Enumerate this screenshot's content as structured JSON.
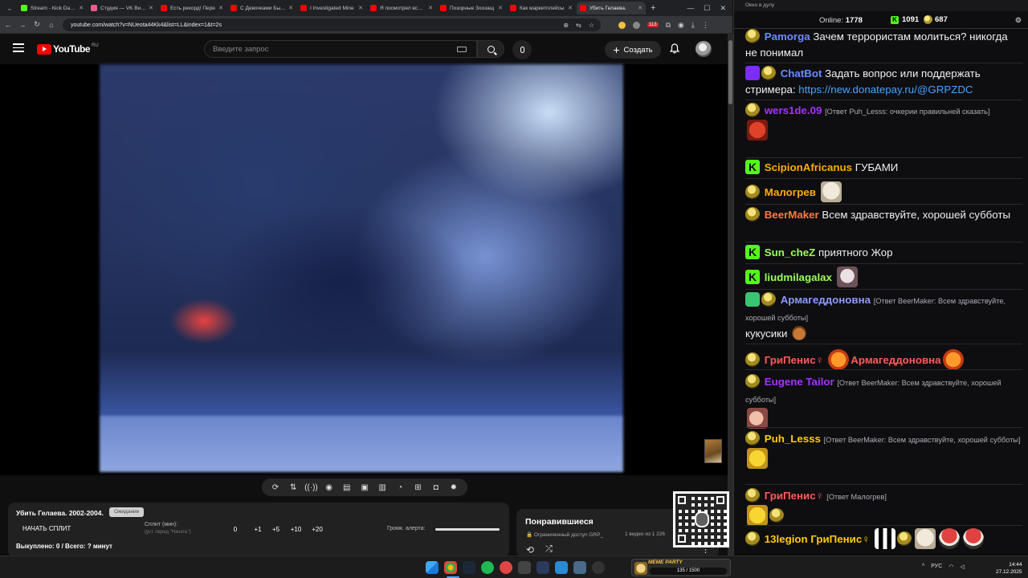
{
  "browser": {
    "tabs": [
      {
        "label": "Stream - Kick Dashb",
        "color": "#53fc18",
        "active": false
      },
      {
        "label": "Студия — VK Видео",
        "color": "#e85d8a",
        "active": false
      },
      {
        "label": "Есть рекорд! Пере",
        "color": "#ff0000",
        "active": false
      },
      {
        "label": "С Девочками Было",
        "color": "#ff0000",
        "active": false
      },
      {
        "label": "I Investigated Mine",
        "color": "#ff0000",
        "active": false
      },
      {
        "label": "Я посмотрел все ф",
        "color": "#ff0000",
        "active": false
      },
      {
        "label": "Позорные Зоозащ",
        "color": "#ff0000",
        "active": false
      },
      {
        "label": "Как маркетплейсы",
        "color": "#ff0000",
        "active": false
      },
      {
        "label": "Убить Гелаева.",
        "color": "#ff0000",
        "active": true
      }
    ],
    "url": "youtube.com/watch?v=NUeota44Kk4&list=LL&index=1&t=2s",
    "ext_badge": "113"
  },
  "youtube": {
    "logo_text": "YouTube",
    "region": "RU",
    "search_placeholder": "Введите запрос",
    "create_label": "Создать"
  },
  "panel": {
    "title": "Убить Гелаева. 2002-2004.",
    "badge": "Ожидание",
    "split_button": "НАЧАТЬ СПЛИТ",
    "split_label": "Сплит (мин):",
    "split_hint": "(уст. перед \"Начать\")",
    "split_values": [
      "0",
      "+1",
      "+5",
      "+10",
      "+20"
    ],
    "alert_label": "Громк. алерта:",
    "alert_level": 1.0,
    "footer": "Выкуплено: 0 / Всего: ? минут"
  },
  "liked": {
    "title": "Понравившиеся",
    "access": "🔒 Ограниченный доступ  GRP_",
    "count": "1 видео из 1 226"
  },
  "chat": {
    "top_title": "Окно в дулу",
    "online_label": "Online:",
    "online_value": "1778",
    "kick_value": "1091",
    "coin_value": "687",
    "messages": [
      {
        "user": "Pamorga",
        "color": "#6b8cff",
        "text": "Зачем террористам молиться? никогда не понимал"
      },
      {
        "user": "ChatBot",
        "color": "#6b8cff",
        "text": "Задать вопрос или поддержать стримера:",
        "link": "https://new.donatepay.ru/@GRPZDC"
      },
      {
        "user": "wers1de.09",
        "color": "#a633ff",
        "reply": "[Ответ Puh_Lesss: очкерии правильней сказать]"
      },
      {
        "user": "ScipionAfricanus",
        "color": "#ffaa00",
        "text": "ГУБАМИ"
      },
      {
        "user": "Малогрев",
        "color": "#ffaa00",
        "text": ""
      },
      {
        "user": "BeerMaker",
        "color": "#ff7a45",
        "text": "Всем здравствуйте, хорошей субботы"
      },
      {
        "user": "Sun_cheZ",
        "color": "#9bff5a",
        "text": "приятного Жор"
      },
      {
        "user": "liudmilagalax",
        "color": "#9bff5a",
        "text": ""
      },
      {
        "user": "Армагеддоновна",
        "color": "#8c9bff",
        "reply": "[Ответ BeerMaker: Всем здравствуйте, хорошей субботы]",
        "text": "кукусики"
      },
      {
        "user": "ГриПенис♀",
        "color": "#ff5a5a",
        "mention": "Армагеддоновна",
        "mention_color": "#ff5a5a"
      },
      {
        "user": "Eugene Tailor",
        "color": "#a633ff",
        "reply": "[Ответ BeerMaker: Всем здравствуйте, хорошей субботы]"
      },
      {
        "user": "Puh_Lesss",
        "color": "#ffcc00",
        "reply": "[Ответ BeerMaker: Всем здравствуйте, хорошей субботы]"
      },
      {
        "user": "ГриПенис♀",
        "color": "#ff5a5a",
        "reply": "[Ответ Малогрев]"
      },
      {
        "user": "13legion",
        "color": "#ffcc00",
        "mention": "ГриПенис♀",
        "mention_color": "#ffcc00"
      }
    ]
  },
  "taskbar": {
    "widget_title": "MEME PARTY",
    "widget_progress": "135 / 1500",
    "lang": "РУС",
    "time": "14:44",
    "date": "27.12.2025"
  }
}
